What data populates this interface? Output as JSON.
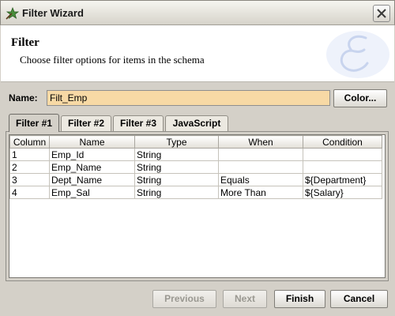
{
  "window": {
    "title": "Filter Wizard"
  },
  "header": {
    "title": "Filter",
    "subtitle": "Choose filter options for items in the schema"
  },
  "name_field": {
    "label": "Name:",
    "value": "Filt_Emp",
    "color_button_label": "Color..."
  },
  "tabs": [
    {
      "label": "Filter #1",
      "active": true
    },
    {
      "label": "Filter #2",
      "active": false
    },
    {
      "label": "Filter #3",
      "active": false
    },
    {
      "label": "JavaScript",
      "active": false
    }
  ],
  "table": {
    "columns": [
      "Column",
      "Name",
      "Type",
      "When",
      "Condition"
    ],
    "rows": [
      [
        "1",
        "Emp_Id",
        "String",
        "",
        ""
      ],
      [
        "2",
        "Emp_Name",
        "String",
        "",
        ""
      ],
      [
        "3",
        "Dept_Name",
        "String",
        "Equals",
        "${Department}"
      ],
      [
        "4",
        "Emp_Sal",
        "String",
        "More Than",
        "${Salary}"
      ]
    ]
  },
  "buttons": {
    "previous": "Previous",
    "next": "Next",
    "finish": "Finish",
    "cancel": "Cancel"
  },
  "colors": {
    "name_input_background": "#f7d9a5",
    "dialog_background": "#d4d0c8"
  }
}
